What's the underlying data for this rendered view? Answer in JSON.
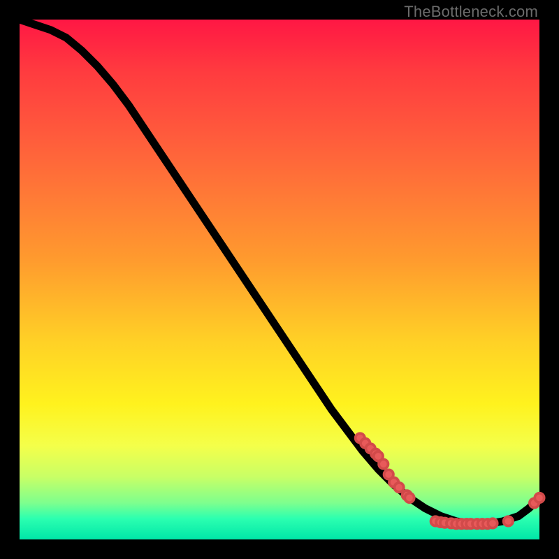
{
  "watermark": "TheBottleneck.com",
  "colors": {
    "line": "#000000",
    "marker": "#e85a5a",
    "background_top": "#ff1744",
    "background_bottom": "#00e6a8"
  },
  "chart_data": {
    "type": "line",
    "title": "",
    "xlabel": "",
    "ylabel": "",
    "xlim": [
      0,
      100
    ],
    "ylim": [
      0,
      100
    ],
    "grid": false,
    "legend": false,
    "curve": {
      "name": "bottleneck-curve",
      "x": [
        0,
        3,
        6,
        9,
        12,
        15,
        18,
        21,
        24,
        27,
        30,
        33,
        36,
        39,
        42,
        45,
        48,
        51,
        54,
        57,
        60,
        63,
        66,
        69,
        72,
        75,
        78,
        81,
        84,
        87,
        90,
        93,
        96,
        98,
        100
      ],
      "y": [
        100,
        99,
        98,
        96.5,
        94,
        91,
        87.5,
        83.5,
        79,
        74.5,
        70,
        65.5,
        61,
        56.5,
        52,
        47.5,
        43,
        38.5,
        34,
        29.5,
        25,
        21,
        17,
        13.5,
        10.5,
        8,
        6,
        4.5,
        3.5,
        3,
        3,
        3.5,
        4.5,
        6,
        8
      ]
    },
    "markers": [
      {
        "x": 65.5,
        "y": 19.5
      },
      {
        "x": 66.5,
        "y": 18.5
      },
      {
        "x": 67.5,
        "y": 17.5
      },
      {
        "x": 68.5,
        "y": 16.5
      },
      {
        "x": 69.0,
        "y": 16.0
      },
      {
        "x": 70.0,
        "y": 14.5
      },
      {
        "x": 71.0,
        "y": 12.5
      },
      {
        "x": 72.0,
        "y": 11.0
      },
      {
        "x": 73.0,
        "y": 10.0
      },
      {
        "x": 74.5,
        "y": 8.5
      },
      {
        "x": 75.0,
        "y": 8.0
      },
      {
        "x": 80.0,
        "y": 3.5
      },
      {
        "x": 81.0,
        "y": 3.3
      },
      {
        "x": 81.8,
        "y": 3.2
      },
      {
        "x": 83.0,
        "y": 3.1
      },
      {
        "x": 84.0,
        "y": 3.0
      },
      {
        "x": 85.0,
        "y": 3.0
      },
      {
        "x": 86.0,
        "y": 3.0
      },
      {
        "x": 86.8,
        "y": 3.0
      },
      {
        "x": 88.0,
        "y": 3.0
      },
      {
        "x": 89.0,
        "y": 3.0
      },
      {
        "x": 90.0,
        "y": 3.0
      },
      {
        "x": 91.0,
        "y": 3.1
      },
      {
        "x": 94.0,
        "y": 3.5
      },
      {
        "x": 99.0,
        "y": 7.0
      },
      {
        "x": 100.0,
        "y": 8.0
      }
    ]
  }
}
